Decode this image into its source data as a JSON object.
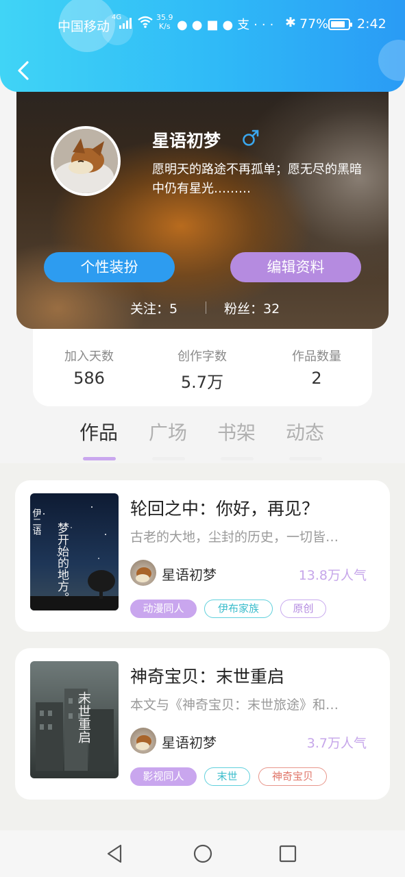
{
  "status_bar": {
    "carrier": "中国移动",
    "network": "4G",
    "speed_value": "35.9",
    "speed_unit": "K/s",
    "battery": "77%",
    "time": "2:42"
  },
  "profile": {
    "username": "星语初梦",
    "gender": "male",
    "bio": "愿明天的路途不再孤单；愿无尽的黑暗中仍有星光………",
    "buttons": {
      "dress_up": "个性装扮",
      "edit_profile": "编辑资料"
    },
    "following_label": "关注：",
    "following": "5",
    "followers_label": "粉丝：",
    "followers": "32"
  },
  "stats": [
    {
      "label": "加入天数",
      "value": "586"
    },
    {
      "label": "创作字数",
      "value": "5.7万"
    },
    {
      "label": "作品数量",
      "value": "2"
    }
  ],
  "tabs": [
    {
      "label": "作品",
      "active": true
    },
    {
      "label": "广场",
      "active": false
    },
    {
      "label": "书架",
      "active": false
    },
    {
      "label": "动态",
      "active": false
    }
  ],
  "works": [
    {
      "title": "轮回之中：你好，再见？",
      "description": "古老的大地，尘封的历史，一切皆…",
      "author": "星语初梦",
      "popularity": "13.8万人气",
      "tags": [
        "动漫同人",
        "伊布家族",
        "原创"
      ],
      "cover_text": "梦开始的地方。",
      "cover_text_top": "伊二语"
    },
    {
      "title": "神奇宝贝：末世重启",
      "description": "本文与《神奇宝贝：末世旅途》和…",
      "author": "星语初梦",
      "popularity": "3.7万人气",
      "tags": [
        "影视同人",
        "末世",
        "神奇宝贝"
      ],
      "cover_text": "末世重启"
    }
  ],
  "colors": {
    "header_gradient": [
      "#40d4f6",
      "#2a9bf5"
    ],
    "dress_button": "#2d9cf0",
    "edit_button": "#b58be0",
    "accent_purple": "#c9a6ee",
    "tab_indicator": "#c9a7ee"
  }
}
